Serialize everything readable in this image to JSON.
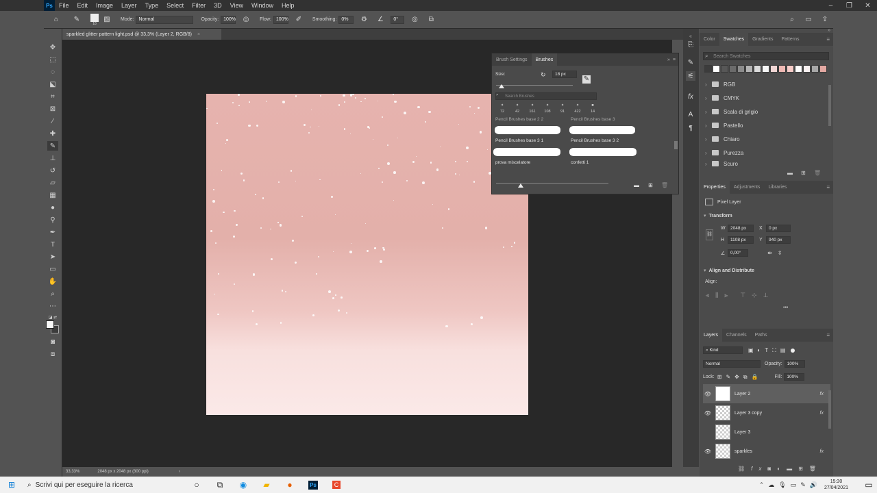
{
  "menu": {
    "logo": "Ps",
    "items": [
      "File",
      "Edit",
      "Image",
      "Layer",
      "Type",
      "Select",
      "Filter",
      "3D",
      "View",
      "Window",
      "Help"
    ]
  },
  "window_controls": [
    "–",
    "❐",
    "✕"
  ],
  "options_bar": {
    "brush_size": "18",
    "mode_label": "Mode:",
    "mode_value": "Normal",
    "opacity_label": "Opacity:",
    "opacity_value": "100%",
    "flow_label": "Flow:",
    "flow_value": "100%",
    "smoothing_label": "Smoothing:",
    "smoothing_value": "0%",
    "angle_value": "0°"
  },
  "document_tab": {
    "title": "sparkled glitter pattern light.psd @ 33,3% (Layer 2, RGB/8)",
    "close": "×"
  },
  "status_bar": {
    "zoom": "33,33%",
    "doc_info": "2048 px x 2048 px (300 ppi)",
    "arrow": "›"
  },
  "brush_panel": {
    "tabs": [
      "Brush Settings",
      "Brushes"
    ],
    "active_tab": "Brushes",
    "size_label": "Size:",
    "size_value": "18 px",
    "search_placeholder": "Search Brushes",
    "recent_sizes": [
      "72",
      "42",
      "161",
      "108",
      "91",
      "422",
      "14"
    ],
    "top_group_left": "Pencil Brushes base 2 2",
    "top_group_right": "Pencil Brushes base 3",
    "brushes": [
      "Pencil Brushes base 3 1",
      "Pencil Brushes base 3 2",
      "prova miscelatore",
      "confetti 1"
    ]
  },
  "swatches_panel": {
    "tabs": [
      "Color",
      "Swatches",
      "Gradients",
      "Patterns"
    ],
    "active_tab": "Swatches",
    "search_placeholder": "Search Swatches",
    "swatch_colors": [
      "#3c3c3c",
      "#ffffff",
      "#575757",
      "#6b6b6b",
      "#8c8c8c",
      "#b5b5b5",
      "#dcdcdc",
      "#f7f7f7",
      "#f2d7d5",
      "#efb9b4",
      "#f7cdc9",
      "#ffffff",
      "#f9f2f2",
      "#a8a8a8",
      "#e4a9a3"
    ],
    "folders": [
      "RGB",
      "CMYK",
      "Scala di grigio",
      "Pastello",
      "Chiaro",
      "Purezza",
      "Scuro"
    ]
  },
  "properties_panel": {
    "tabs": [
      "Properties",
      "Adjustments",
      "Libraries"
    ],
    "active_tab": "Properties",
    "layer_type": "Pixel Layer",
    "transform_title": "Transform",
    "w_label": "W",
    "w_value": "2048 px",
    "h_label": "H",
    "h_value": "1108 px",
    "x_label": "X",
    "x_value": "0 px",
    "y_label": "Y",
    "y_value": "940 px",
    "angle_value": "0,00°",
    "align_title": "Align and Distribute",
    "align_label": "Align:",
    "more": "•••"
  },
  "layers_panel": {
    "tabs": [
      "Layers",
      "Channels",
      "Paths"
    ],
    "active_tab": "Layers",
    "filter_kind": "Kind",
    "blend_mode": "Normal",
    "opacity_label": "Opacity:",
    "opacity_value": "100%",
    "lock_label": "Lock:",
    "fill_label": "Fill:",
    "fill_value": "100%",
    "layers": [
      {
        "name": "Layer 2",
        "visible": "👁",
        "fx": "fx"
      },
      {
        "name": "Layer 3 copy",
        "visible": "👁",
        "fx": "fx"
      },
      {
        "name": "Layer 3",
        "visible": "",
        "fx": ""
      },
      {
        "name": "sparkles",
        "visible": "👁",
        "fx": "fx"
      }
    ]
  },
  "taskbar": {
    "search_text": "Scrivi qui per eseguire la ricerca",
    "time": "15:30",
    "date": "27/04/2021"
  }
}
